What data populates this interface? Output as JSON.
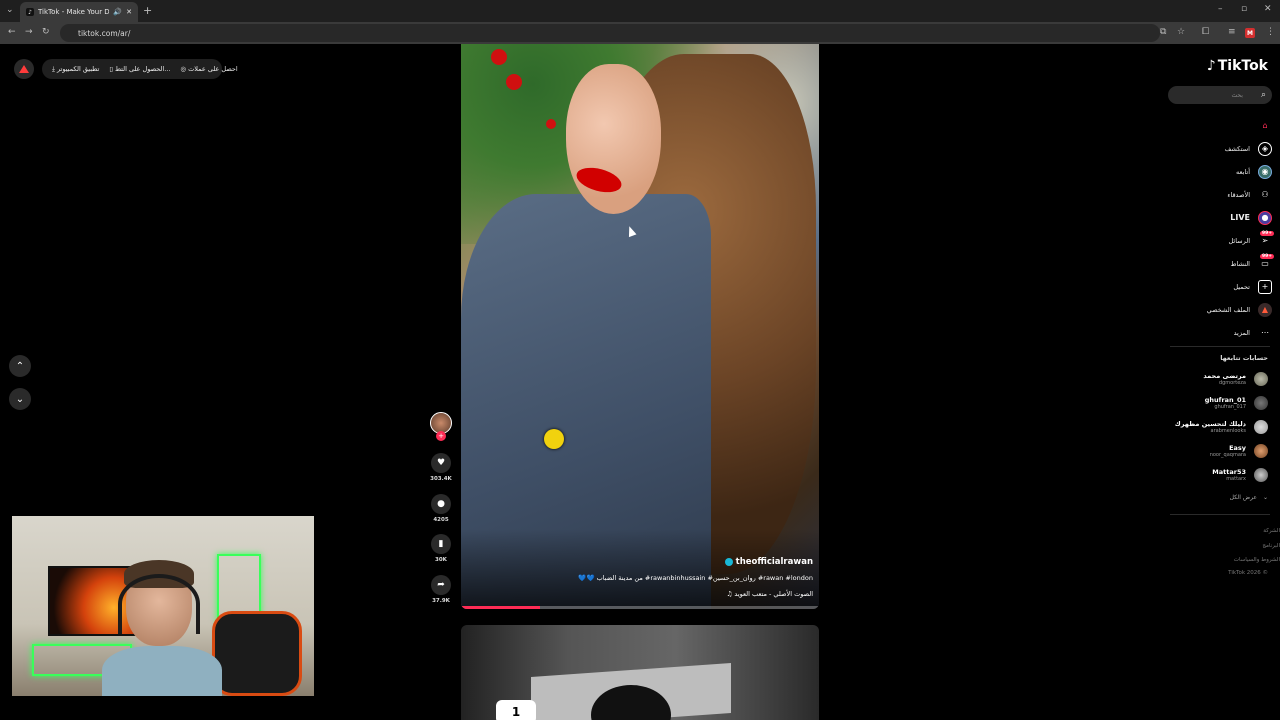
{
  "browser": {
    "tab_title": "TikTok - Make Your Day",
    "tab_favicon": "tiktok-logo",
    "url": "tiktok.com/ar/",
    "extension_badge": "M"
  },
  "top_bar": {
    "items": [
      "تطبيق الكمبيوتر",
      "الحصول على التط...",
      "احصل على عملات"
    ]
  },
  "video": {
    "author": "theofficialrawan",
    "description": "💙💙 من مدينة الضباب #rawanbinhussain #روان_بن_حسين #rawan #london",
    "sound": "♫ الصوت الأصلي - متعب العويد",
    "progress_percent": 22,
    "likes": "303.4K",
    "comments": "4205",
    "saves": "30K",
    "shares": "37.9K"
  },
  "next_video": {
    "badge": "1"
  },
  "sidebar": {
    "logo_text": "TikTok",
    "search_placeholder": "بحث",
    "menu": [
      {
        "label": "",
        "icon": "home-icon",
        "badge": ""
      },
      {
        "label": "استكشف",
        "icon": "compass-icon",
        "badge": ""
      },
      {
        "label": "أتابعه",
        "icon": "following-icon",
        "badge": ""
      },
      {
        "label": "الأصدقاء",
        "icon": "friends-icon",
        "badge": ""
      },
      {
        "label": "LIVE",
        "icon": "live-icon",
        "badge": ""
      },
      {
        "label": "الرسائل",
        "icon": "messages-icon",
        "badge": "99+"
      },
      {
        "label": "النشاط",
        "icon": "inbox-icon",
        "badge": "99+"
      },
      {
        "label": "تحميل",
        "icon": "upload-icon",
        "badge": ""
      },
      {
        "label": "الملف الشخصي",
        "icon": "profile-icon",
        "badge": ""
      },
      {
        "label": "المزيد",
        "icon": "more-icon",
        "badge": ""
      }
    ],
    "following_title": "حسابات تتابعها",
    "following": [
      {
        "name": "مرتضى محمد",
        "username": "dgmorteza"
      },
      {
        "name": "ghufran_01",
        "username": "ghufran_017"
      },
      {
        "name": "دليلك لتحسين مظهرك",
        "username": "arabmenlooks"
      },
      {
        "name": "Easy",
        "username": "noor_qaqmara"
      },
      {
        "name": "Mattar53",
        "username": "mattarx"
      }
    ],
    "see_all": "عرض الكل",
    "footer": [
      "الشركة",
      "البرنامج",
      "الشروط والسياسات",
      "TikTok 2026 ©"
    ]
  },
  "colors": {
    "accent": "#fe2c55",
    "page_bg": "#000000",
    "author_dot": "#19b8d6"
  }
}
